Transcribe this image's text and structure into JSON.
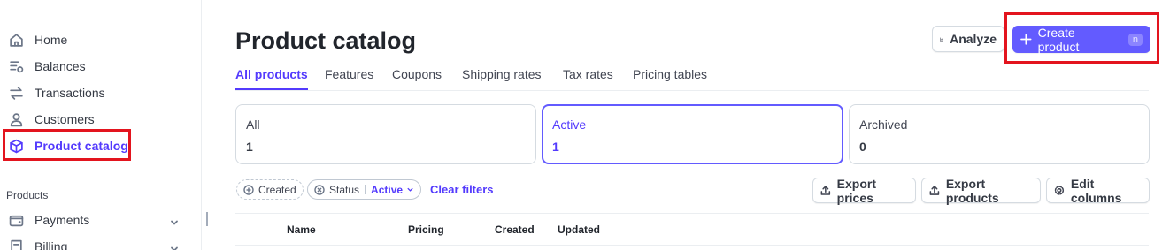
{
  "sidebar": {
    "items": [
      {
        "label": "Home",
        "icon": "home-icon"
      },
      {
        "label": "Balances",
        "icon": "balances-icon"
      },
      {
        "label": "Transactions",
        "icon": "transactions-icon"
      },
      {
        "label": "Customers",
        "icon": "customers-icon"
      },
      {
        "label": "Product catalog",
        "icon": "box-icon",
        "active": true
      }
    ],
    "section_label": "Products",
    "section_items": [
      {
        "label": "Payments",
        "icon": "wallet-icon"
      },
      {
        "label": "Billing",
        "icon": "billing-icon"
      }
    ]
  },
  "header": {
    "title": "Product catalog",
    "analyze_label": "Analyze",
    "create_label": "Create product",
    "create_shortcut": "n"
  },
  "tabs": [
    "All products",
    "Features",
    "Coupons",
    "Shipping rates",
    "Tax rates",
    "Pricing tables"
  ],
  "status_cards": [
    {
      "label": "All",
      "count": "1"
    },
    {
      "label": "Active",
      "count": "1"
    },
    {
      "label": "Archived",
      "count": "0"
    }
  ],
  "filters": {
    "created_label": "Created",
    "status_label": "Status",
    "status_value": "Active",
    "clear_label": "Clear filters"
  },
  "actions": {
    "export_prices": "Export prices",
    "export_products": "Export products",
    "edit_columns": "Edit columns"
  },
  "table": {
    "columns": [
      "Name",
      "Pricing",
      "Created",
      "Updated"
    ]
  },
  "colors": {
    "accent": "#533afd",
    "primary_button": "#635bff",
    "highlight_box": "#e3141e"
  }
}
